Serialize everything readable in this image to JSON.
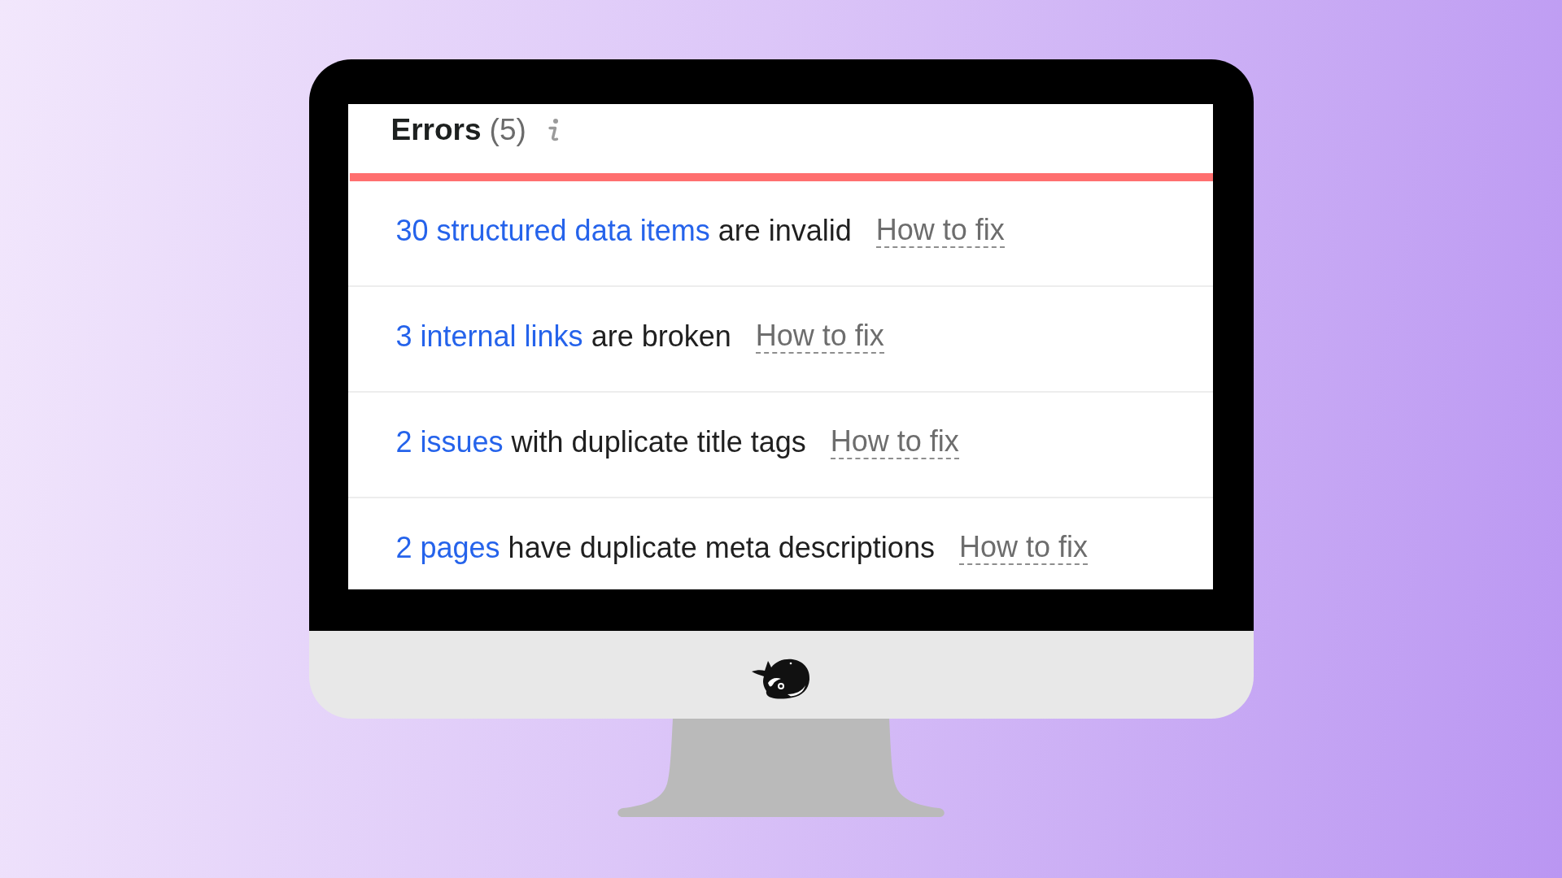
{
  "panel": {
    "title": "Errors",
    "count": "(5)"
  },
  "issues": [
    {
      "link": "30 structured data items",
      "text": "are invalid",
      "fix": "How to fix"
    },
    {
      "link": "3 internal links",
      "text": "are broken",
      "fix": "How to fix"
    },
    {
      "link": "2 issues",
      "text": "with duplicate title tags",
      "fix": "How to fix"
    },
    {
      "link": "2 pages",
      "text": "have duplicate meta descriptions",
      "fix": "How to fix"
    }
  ]
}
